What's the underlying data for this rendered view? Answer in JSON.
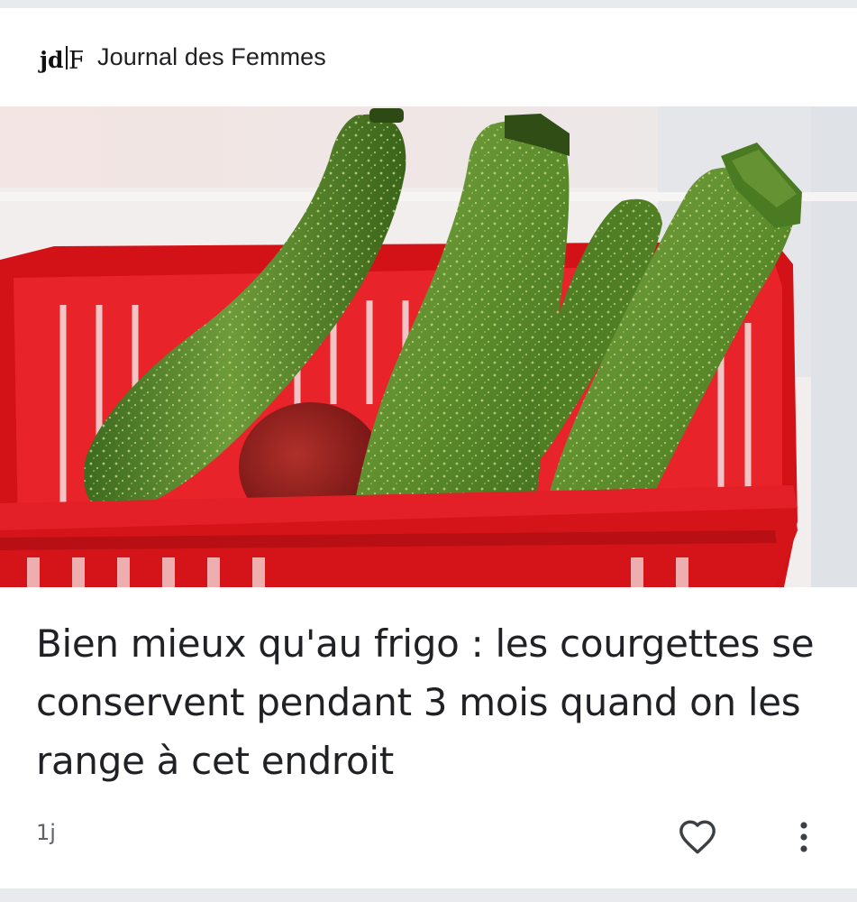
{
  "header": {
    "logo_text": "jdF",
    "source_name": "Journal des Femmes"
  },
  "hero_image": {
    "subject": "courgettes-in-red-basket",
    "colors": {
      "basket": "#e3161c",
      "courgette": "#5b8a2e",
      "background": "#f0e6e4"
    }
  },
  "article": {
    "headline": "Bien mieux qu'au frigo : les courgettes se conservent pendant 3 mois quand on les range à cet endroit",
    "age": "1j"
  },
  "actions": {
    "like_icon": "heart-icon",
    "more_icon": "more-vert-icon"
  }
}
